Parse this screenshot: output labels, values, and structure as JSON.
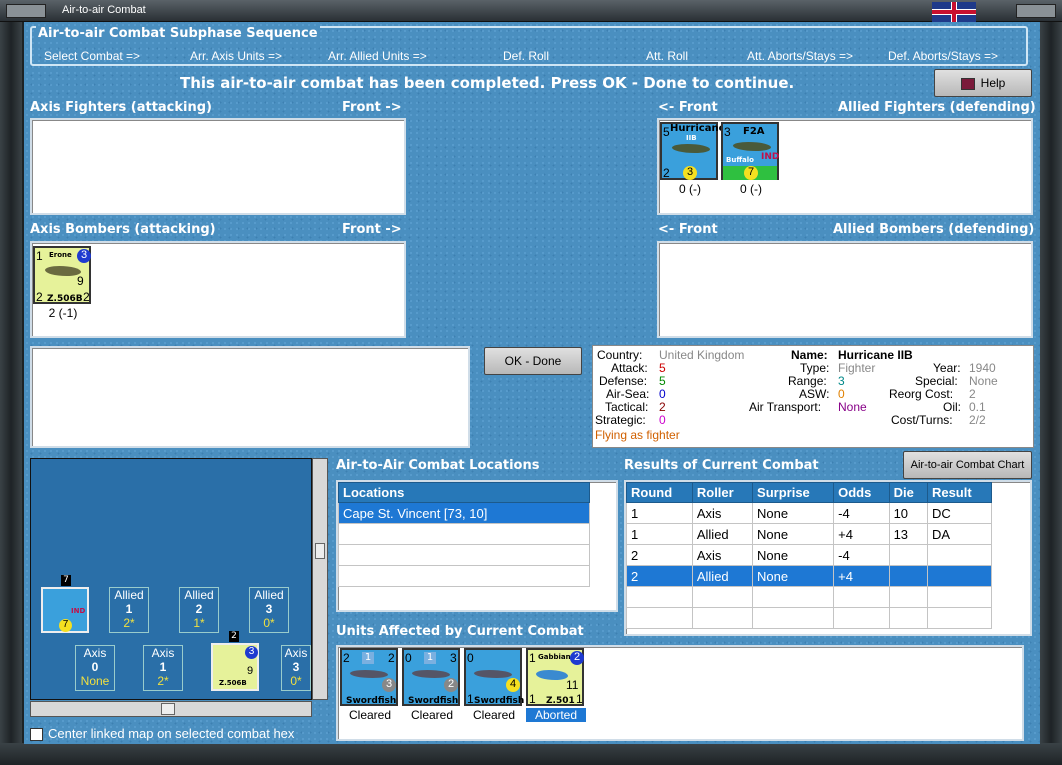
{
  "window": {
    "title": "Air-to-air Combat"
  },
  "sequence": {
    "title": "Air-to-air Combat Subphase Sequence",
    "steps": [
      "Select Combat =>",
      "Arr. Axis Units =>",
      "Arr. Allied Units =>",
      "Def. Roll",
      "Att. Roll",
      "Att. Aborts/Stays =>",
      "Def. Aborts/Stays =>"
    ]
  },
  "message": "This air-to-air combat has been completed.  Press OK - Done to continue.",
  "help_label": "Help",
  "sections": {
    "axis_fighters": "Axis Fighters (attacking)",
    "front_right": "Front ->",
    "allied_fighters": "Allied Fighters (defending)",
    "front_left": "<- Front",
    "axis_bombers": "Axis Bombers (attacking)",
    "allied_bombers": "Allied Bombers (defending)"
  },
  "units": {
    "hurricane": {
      "name": "Hurricane",
      "sub": "IIB",
      "top": "5",
      "att": "2",
      "def": "3",
      "caption": "0 (-)"
    },
    "f2a": {
      "name": "F2A",
      "sub": "Buffalo",
      "tag": "IND",
      "top": "3",
      "att": "7",
      "caption": "0 (-)"
    },
    "erone": {
      "name": "Erone",
      "model": "Z.506B",
      "tl": "1",
      "tr": "3",
      "bl": "2",
      "br": "2",
      "mid": "9",
      "caption": "2 (-1)"
    }
  },
  "ok_label": "OK - Done",
  "info": {
    "country_l": "Country:",
    "country": "United Kingdom",
    "attack_l": "Attack:",
    "attack": "5",
    "defense_l": "Defense:",
    "defense": "5",
    "airsea_l": "Air-Sea:",
    "airsea": "0",
    "tactical_l": "Tactical:",
    "tactical": "2",
    "strategic_l": "Strategic:",
    "strategic": "0",
    "flying": "Flying as fighter",
    "name_l": "Name:",
    "name": "Hurricane IIB",
    "type_l": "Type:",
    "type": "Fighter",
    "range_l": "Range:",
    "range": "3",
    "asw_l": "ASW:",
    "asw": "0",
    "airtrans_l": "Air Transport:",
    "airtrans": "None",
    "year_l": "Year:",
    "year": "1940",
    "special_l": "Special:",
    "special": "None",
    "reorg_l": "Reorg Cost:",
    "reorg": "2",
    "oil_l": "Oil:",
    "oil": "0.1",
    "cost_l": "Cost/Turns:",
    "cost": "2/2"
  },
  "locations": {
    "title": "Air-to-Air Combat Locations",
    "header": "Locations",
    "rows": [
      "Cape St. Vincent [73, 10]"
    ]
  },
  "results": {
    "title": "Results of Current Combat",
    "chart_btn": "Air-to-air Combat Chart",
    "headers": [
      "Round",
      "Roller",
      "Surprise",
      "Odds",
      "Die",
      "Result"
    ],
    "rows": [
      [
        "1",
        "Axis",
        "None",
        "-4",
        "10",
        "DC"
      ],
      [
        "1",
        "Allied",
        "None",
        "+4",
        "13",
        "DA"
      ],
      [
        "2",
        "Axis",
        "None",
        "-4",
        "",
        ""
      ],
      [
        "2",
        "Allied",
        "None",
        "+4",
        "",
        ""
      ]
    ]
  },
  "affected": {
    "title": "Units Affected by Current Combat",
    "units": [
      {
        "name": "Swordfish",
        "status": "Cleared",
        "tl": "2",
        "tr": "2",
        "mid": "1",
        "br": "3",
        "bl": "1"
      },
      {
        "name": "Swordfish",
        "status": "Cleared",
        "tl": "0",
        "tr": "3",
        "mid": "1",
        "br": "2",
        "bl": "1"
      },
      {
        "name": "Swordfish",
        "status": "Cleared",
        "tl": "0",
        "tr": "4",
        "br": "4",
        "bl": "1"
      },
      {
        "name": "Gabbiano",
        "model": "Z.501",
        "status": "Aborted",
        "tl": "1",
        "tr": "2",
        "mid": "11",
        "bl": "1",
        "br": "1"
      }
    ]
  },
  "map": {
    "tiles": [
      {
        "side": "Allied",
        "n": "1",
        "v": "2*"
      },
      {
        "side": "Allied",
        "n": "2",
        "v": "1*"
      },
      {
        "side": "Allied",
        "n": "3",
        "v": "0*"
      },
      {
        "side": "Axis",
        "n": "0",
        "v": "None"
      },
      {
        "side": "Axis",
        "n": "1",
        "v": "2*"
      },
      {
        "side": "Axis",
        "n": "3",
        "v": "0*"
      }
    ],
    "stack_a": "7",
    "stack_b": "2"
  },
  "center_label": "Center linked map on selected combat hex"
}
